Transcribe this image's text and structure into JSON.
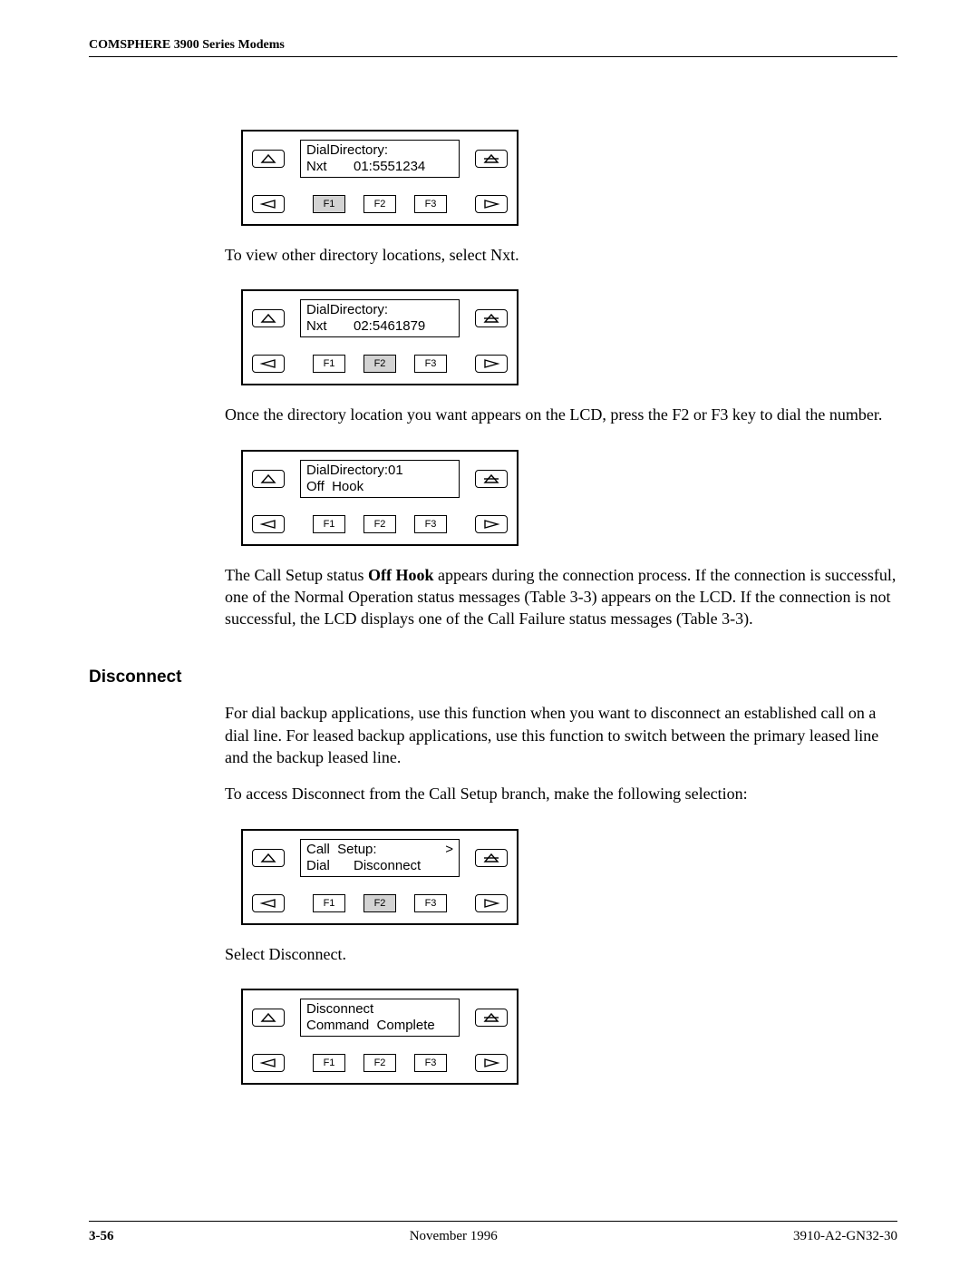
{
  "header": "COMSPHERE 3900 Series Modems",
  "panels": [
    {
      "line1": "DialDirectory:",
      "line2_col1": "Nxt",
      "line2_col2": "01:5551234",
      "hl": [
        true,
        false,
        false
      ]
    },
    {
      "line1": "DialDirectory:",
      "line2_col1": "Nxt",
      "line2_col2": "02:5461879",
      "hl": [
        false,
        true,
        false
      ]
    },
    {
      "line1": "DialDirectory:01",
      "line2_col1": "Off  Hook",
      "line2_col2": "",
      "hl": [
        false,
        false,
        false
      ]
    },
    {
      "line1": "Call  Setup:",
      "line1_right": ">",
      "line2_col1": "Dial",
      "line2_col2": "Disconnect",
      "hl": [
        false,
        true,
        false
      ]
    },
    {
      "line1": "Disconnect",
      "line2_col1": "Command  Complete",
      "line2_col2": "",
      "hl": [
        false,
        false,
        false
      ]
    }
  ],
  "fkeys": [
    "F1",
    "F2",
    "F3"
  ],
  "text": {
    "p1": "To view other directory locations, select Nxt.",
    "p2": "Once the directory location you want appears on the LCD, press the F2 or F3 key to dial the number.",
    "p3a": "The Call Setup status ",
    "p3b": "Off Hook",
    "p3c": " appears during the connection process. If the connection is successful, one of the Normal Operation status messages (Table 3-3) appears on the LCD. If the connection is not successful, the LCD displays one of the Call Failure status messages (Table 3-3).",
    "h1": "Disconnect",
    "p4": "For dial backup applications, use this function when you want to disconnect an established call on a dial line. For leased backup applications, use this function to switch between the primary leased line and the backup leased line.",
    "p5": "To access Disconnect from the Call Setup branch, make the following selection:",
    "p6": "Select Disconnect."
  },
  "footer": {
    "page": "3-56",
    "date": "November 1996",
    "docid": "3910-A2-GN32-30"
  }
}
